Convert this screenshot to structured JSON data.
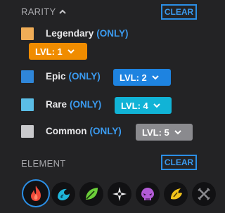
{
  "rarity": {
    "heading": "RARITY",
    "clear_label": "CLEAR",
    "items": [
      {
        "name": "Legendary",
        "only": "(ONLY)",
        "level": "LVL: 1",
        "color": "#f0ad57",
        "level_color": "#f08c00"
      },
      {
        "name": "Epic",
        "only": "(ONLY)",
        "level": "LVL: 2",
        "color": "#2f86d9",
        "level_color": "#1e83e0"
      },
      {
        "name": "Rare",
        "only": "(ONLY)",
        "level": "LVL: 4",
        "color": "#5bbde6",
        "level_color": "#11b3d6"
      },
      {
        "name": "Common",
        "only": "(ONLY)",
        "level": "LVL: 5",
        "color": "#c9c9cc",
        "level_color": "#8a8a8e"
      }
    ]
  },
  "element": {
    "heading": "ELEMENT",
    "clear_label": "CLEAR",
    "icons": [
      {
        "name": "fire-icon",
        "selected": true
      },
      {
        "name": "water-icon",
        "selected": false
      },
      {
        "name": "leaf-icon",
        "selected": false
      },
      {
        "name": "light-icon",
        "selected": false
      },
      {
        "name": "dark-icon",
        "selected": false
      },
      {
        "name": "electric-icon",
        "selected": false
      },
      {
        "name": "neutral-icon",
        "selected": false
      }
    ]
  }
}
